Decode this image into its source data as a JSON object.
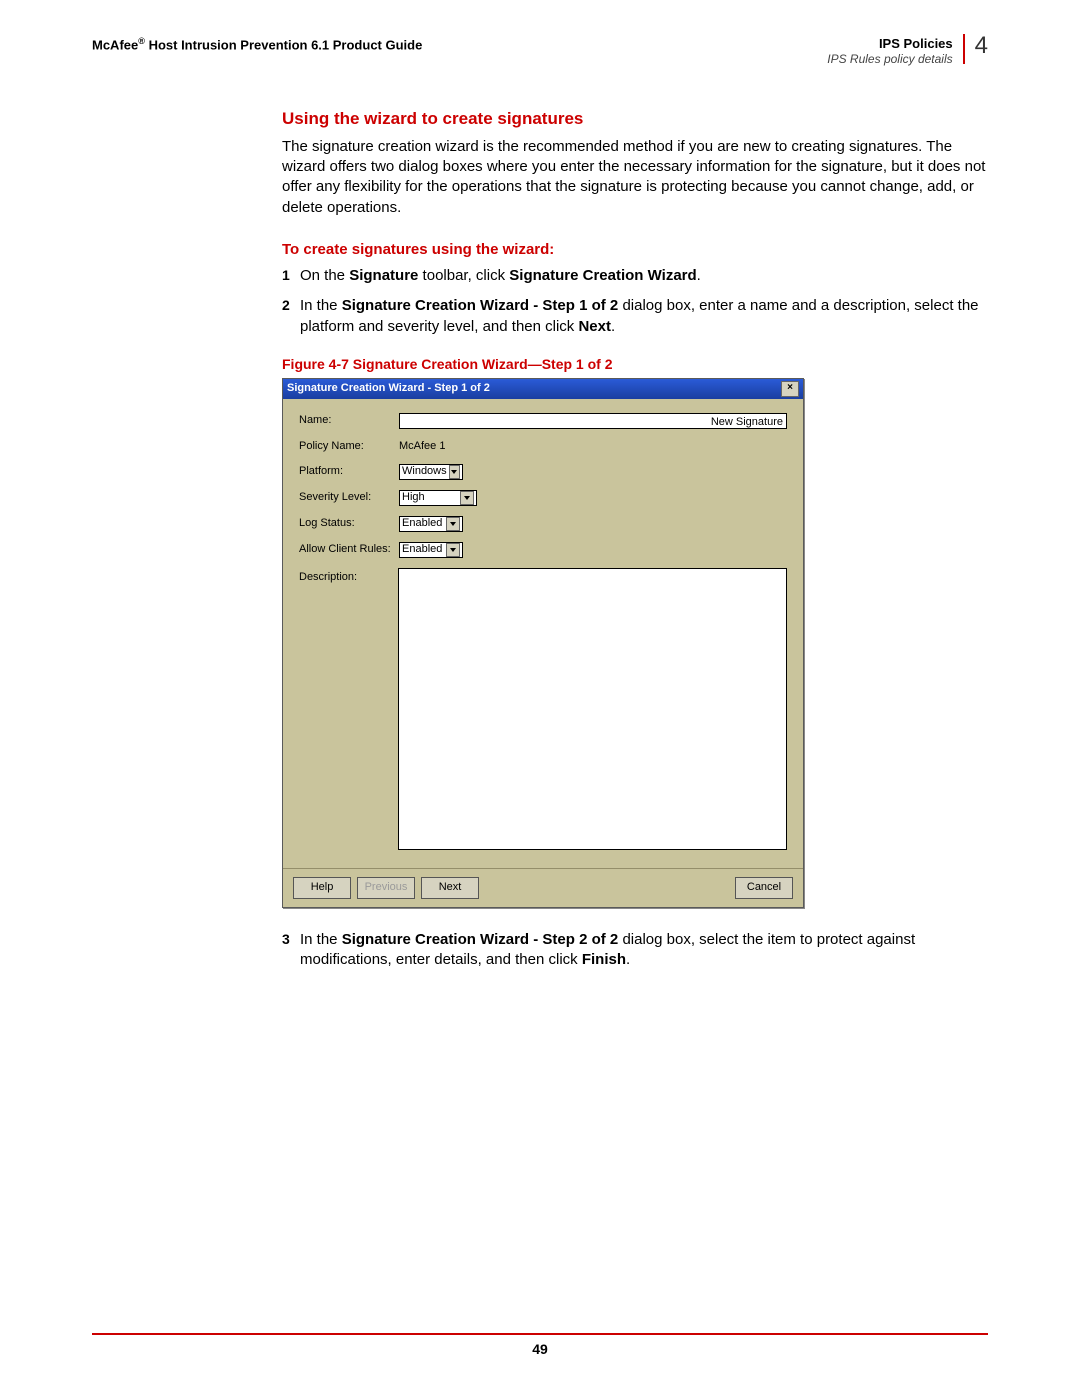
{
  "header": {
    "brand": "McAfee",
    "sup": "®",
    "guide": " Host Intrusion Prevention 6.1 Product Guide",
    "section": "IPS Policies",
    "subsection": "IPS Rules policy details",
    "chapter": "4"
  },
  "h1": "Using the wizard to create signatures",
  "intro": "The signature creation wizard is the recommended method if you are new to creating signatures. The wizard offers two dialog boxes where you enter the necessary information for the signature, but it does not offer any flexibility for the operations that the signature is protecting because you cannot change, add, or delete operations.",
  "sub1": "To create signatures using the wizard:",
  "steps": {
    "s1": {
      "num": "1",
      "t1": "On the ",
      "b1": "Signature",
      "t2": " toolbar, click ",
      "b2": "Signature Creation Wizard",
      "t3": "."
    },
    "s2": {
      "num": "2",
      "t1": "In the ",
      "b1": "Signature Creation Wizard - Step 1 of 2",
      "t2": " dialog box, enter a name and a description, select the platform and severity level, and then click ",
      "b2": "Next",
      "t3": "."
    },
    "s3": {
      "num": "3",
      "t1": "In the ",
      "b1": "Signature Creation Wizard - Step 2 of 2",
      "t2": " dialog box, select the item to protect against modifications, enter details, and then click ",
      "b2": "Finish",
      "t3": "."
    }
  },
  "fig_caption": "Figure 4-7  Signature Creation Wizard—Step 1 of 2",
  "dialog": {
    "title": "Signature Creation Wizard - Step 1 of 2",
    "close": "×",
    "labels": {
      "name": "Name:",
      "policy": "Policy Name:",
      "platform": "Platform:",
      "severity": "Severity Level:",
      "log": "Log Status:",
      "client": "Allow Client Rules:",
      "desc": "Description:"
    },
    "values": {
      "name": "New Signature",
      "policy": "McAfee 1",
      "platform": "Windows",
      "severity": "High",
      "log": "Enabled",
      "client": "Enabled"
    },
    "buttons": {
      "help": "Help",
      "prev": "Previous",
      "next": "Next",
      "cancel": "Cancel"
    }
  },
  "page_number": "49"
}
